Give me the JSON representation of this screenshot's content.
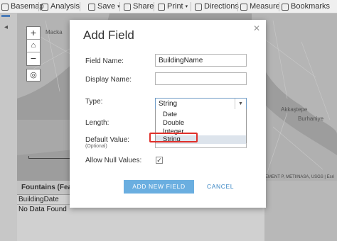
{
  "toolbar": {
    "items": [
      {
        "label": "Basemap",
        "icon": "basemap-icon"
      },
      {
        "label": "Analysis",
        "icon": "analysis-icon"
      },
      {
        "label": "Save",
        "icon": "save-icon"
      },
      {
        "label": "Share",
        "icon": "share-icon"
      },
      {
        "label": "Print",
        "icon": "print-icon"
      },
      {
        "label": "Directions",
        "icon": "directions-icon"
      },
      {
        "label": "Measure",
        "icon": "measure-icon"
      },
      {
        "label": "Bookmarks",
        "icon": "bookmarks-icon"
      }
    ]
  },
  "map": {
    "labels": [
      "Macka",
      "Akkaştepe",
      "Burhaniye"
    ],
    "attribution": "EMENT P, METI/NASA, USGS | Esri"
  },
  "table": {
    "title": "Fountains (Featu",
    "column": "BuildingDate",
    "empty_message": "No Data Found"
  },
  "dialog": {
    "title": "Add Field",
    "close_glyph": "✕",
    "field_name_label": "Field Name:",
    "field_name_value": "BuildingName",
    "display_name_label": "Display Name:",
    "display_name_value": "",
    "type_label": "Type:",
    "type_selected": "String",
    "type_options": [
      "Date",
      "Double",
      "Integer",
      "String"
    ],
    "length_label": "Length:",
    "default_value_label": "Default Value:",
    "default_value_sub": "(Optional)",
    "allow_null_label": "Allow Null Values:",
    "allow_null_checked": true,
    "add_button": "ADD NEW FIELD",
    "cancel_button": "CANCEL"
  },
  "colors": {
    "primary_button": "#6aaee0",
    "link": "#3a86c4",
    "highlight_box": "#e0302a"
  }
}
